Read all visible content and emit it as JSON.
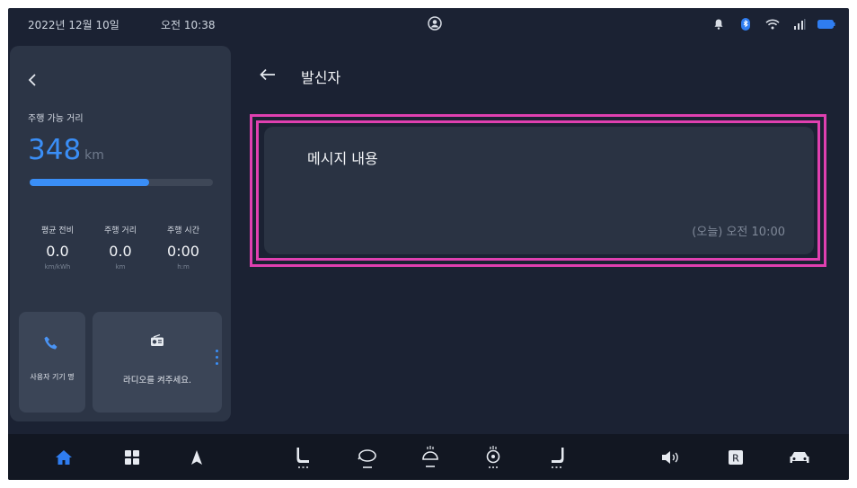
{
  "status_bar": {
    "date": "2022년 12월 10일",
    "time": "오전 10:38",
    "icons": [
      "profile-icon",
      "bell-icon",
      "bluetooth-icon",
      "wifi-icon",
      "signal-icon",
      "battery-icon"
    ]
  },
  "left_panel": {
    "range_label": "주행 가능 거리",
    "range_value": "348",
    "range_unit": "km",
    "range_fill_percent": 65,
    "stats": [
      {
        "label": "평균 전비",
        "value": "0.0",
        "unit": "km/kWh"
      },
      {
        "label": "주행 거리",
        "value": "0.0",
        "unit": "km"
      },
      {
        "label": "주행 시간",
        "value": "0:00",
        "unit": "h:m"
      }
    ],
    "phone_tile_label": "사용자 기기 명",
    "radio_tile_label": "라디오를 켜주세요."
  },
  "main": {
    "title": "발신자",
    "message_text": "메시지 내용",
    "message_time": "(오늘) 오전 10:00"
  },
  "bottom_bar": {
    "left_icons": [
      "home-icon",
      "apps-grid-icon",
      "navigation-icon"
    ],
    "climate_icons": [
      "seat-driver-icon",
      "airflow-icon",
      "rear-defrost-icon",
      "steering-heat-icon",
      "seat-passenger-icon"
    ],
    "right_icons": [
      "volume-icon",
      "radio-r-icon",
      "car-icon"
    ]
  },
  "colors": {
    "background": "#1b2233",
    "accent": "#3a8ef6",
    "highlight": "#e040b0",
    "panel": "#2c3546"
  }
}
